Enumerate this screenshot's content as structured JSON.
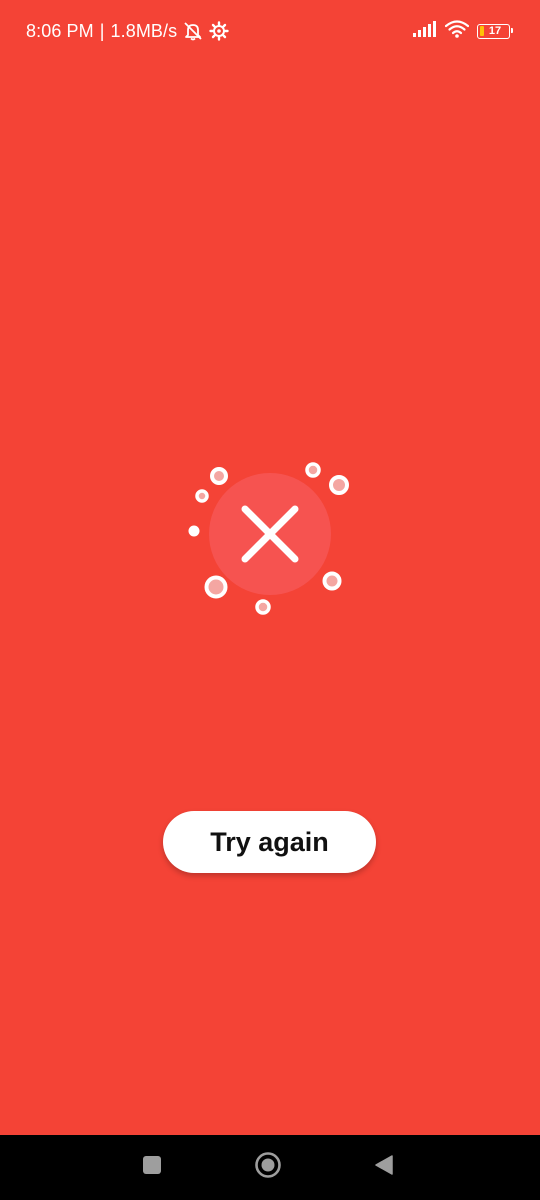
{
  "status_bar": {
    "time": "8:06 PM",
    "separator": "|",
    "network_speed": "1.8MB/s",
    "icons": [
      "notifications-muted-icon",
      "settings-gear-icon",
      "signal-icon",
      "wifi-icon",
      "battery-icon"
    ],
    "battery_level": "17",
    "battery_color": "#FFC107"
  },
  "main": {
    "background_color": "#F44336",
    "status_icon": "error-x-icon",
    "button_label": "Try again"
  },
  "nav_bar": {
    "icons": [
      "recents-square-icon",
      "home-circle-icon",
      "back-triangle-icon"
    ]
  }
}
